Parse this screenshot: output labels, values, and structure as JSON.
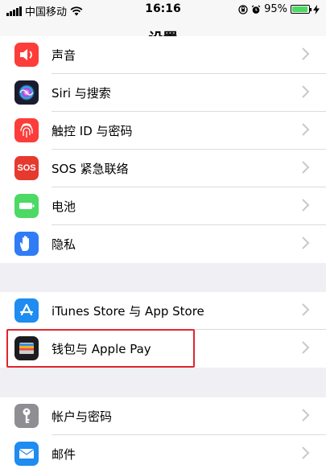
{
  "status_bar": {
    "carrier": "中国移动",
    "time": "16:16",
    "battery_percent": "95%",
    "battery_level": 0.95
  },
  "nav": {
    "title": "设置"
  },
  "groups": [
    {
      "rows": [
        {
          "label": "声音",
          "icon": "speaker-icon",
          "color": "#fc3d39"
        },
        {
          "label": "Siri 与搜索",
          "icon": "siri-icon",
          "color": "#1b1b2f"
        },
        {
          "label": "触控 ID 与密码",
          "icon": "fingerprint-icon",
          "color": "#fc3d39"
        },
        {
          "label": "SOS 紧急联络",
          "icon": "sos-icon",
          "icon_text": "SOS",
          "color": "#e63a2e"
        },
        {
          "label": "电池",
          "icon": "battery-icon",
          "color": "#4cd964"
        },
        {
          "label": "隐私",
          "icon": "hand-icon",
          "color": "#2f7cf6"
        }
      ]
    },
    {
      "rows": [
        {
          "label": "iTunes Store 与 App Store",
          "icon": "app-store-icon",
          "color": "#1e8cf0"
        },
        {
          "label": "钱包与 Apple Pay",
          "icon": "wallet-icon",
          "color": "#1c1c1e"
        }
      ]
    },
    {
      "rows": [
        {
          "label": "帐户与密码",
          "icon": "key-icon",
          "color": "#8e8e93"
        },
        {
          "label": "邮件",
          "icon": "mail-icon",
          "color": "#1e8cf0"
        }
      ]
    }
  ],
  "highlight_color": "#e0262f"
}
